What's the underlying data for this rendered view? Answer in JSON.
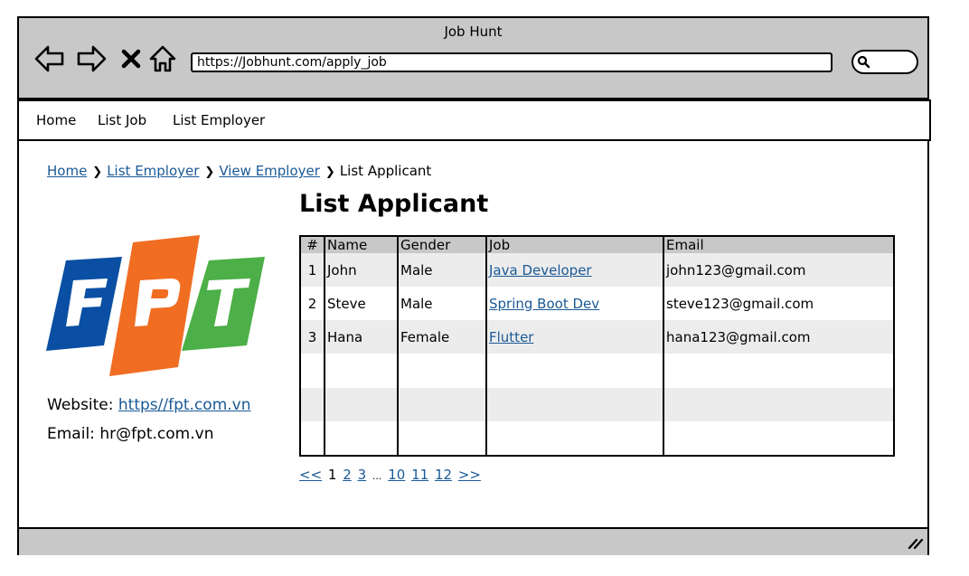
{
  "window": {
    "title": "Job Hunt"
  },
  "browser": {
    "url": "https://Jobhunt.com/apply_job",
    "icons": [
      "back-arrow-icon",
      "forward-arrow-icon",
      "close-icon",
      "home-icon",
      "search-icon"
    ]
  },
  "menu": {
    "items": [
      "Home",
      "List Job",
      "List Employer"
    ]
  },
  "breadcrumb": {
    "items": [
      "Home",
      "List Employer",
      "View Employer",
      "List Applicant"
    ]
  },
  "page": {
    "title": "List Applicant"
  },
  "employer": {
    "logo_text": "FPT",
    "logo_colors": {
      "f": "#0a4fa3",
      "p": "#f06d22",
      "t": "#4caf47"
    },
    "website_label": "Website:",
    "website": "https//fpt.com.vn",
    "email_label": "Email:",
    "email": "hr@fpt.com.vn"
  },
  "table": {
    "columns": [
      "#",
      "Name",
      "Gender",
      "Job",
      "Email"
    ],
    "rows": [
      {
        "num": "1",
        "name": "John",
        "gender": "Male",
        "job": "Java Developer",
        "email": "john123@gmail.com"
      },
      {
        "num": "2",
        "name": "Steve",
        "gender": "Male",
        "job": "Spring Boot Dev",
        "email": "steve123@gmail.com"
      },
      {
        "num": "3",
        "name": "Hana",
        "gender": "Female",
        "job": "Flutter",
        "email": "hana123@gmail.com"
      }
    ]
  },
  "pagination": {
    "prev": "<<",
    "current": "1",
    "pages": [
      "2",
      "3"
    ],
    "ellipsis": "...",
    "tail": [
      "10",
      "11",
      "12"
    ],
    "next": ">>"
  },
  "colors": {
    "chrome": "#c8c8c8",
    "link": "#1a5a96",
    "row_alt": "#ececec"
  }
}
